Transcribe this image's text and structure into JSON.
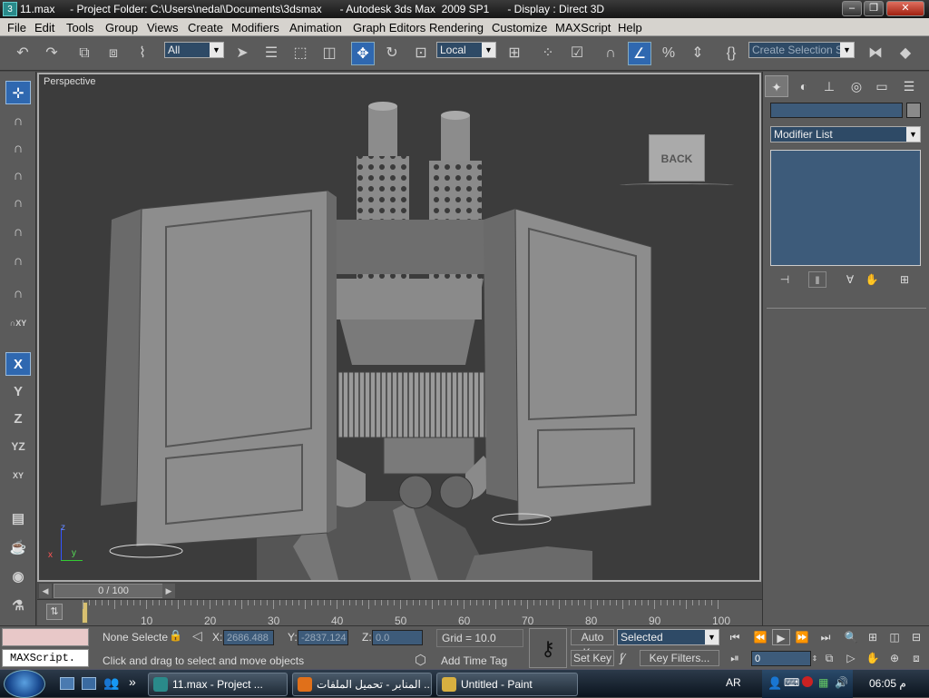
{
  "title_bar": {
    "text": "11.max     - Project Folder: C:\\Users\\nedal\\Documents\\3dsmax      - Autodesk 3ds Max  2009 SP1      - Display : Direct 3D"
  },
  "menu": {
    "items": [
      "File",
      "Edit",
      "Tools",
      "Group",
      "Views",
      "Create",
      "Modifiers",
      "Animation",
      "Graph Editors",
      "Rendering",
      "Customize",
      "MAXScript",
      "Help"
    ]
  },
  "toolbar": {
    "selection_filter": "All",
    "reference_coord": "Local",
    "named_selection_placeholder": "Create Selection Set"
  },
  "axis_constraints": {
    "x": "X",
    "y": "Y",
    "z": "Z",
    "yz": "YZ",
    "xy": "XY"
  },
  "viewport": {
    "label": "Perspective",
    "viewcube_label": "BACK",
    "axis_x": "x",
    "axis_y": "y",
    "axis_z": "z"
  },
  "command_panel": {
    "modifier_list_label": "Modifier List"
  },
  "time_slider": {
    "label": "0 / 100",
    "current": 0,
    "max": 100
  },
  "track_bar": {
    "ticks": [
      "10",
      "20",
      "30",
      "40",
      "50",
      "60",
      "70",
      "80",
      "90",
      "100"
    ]
  },
  "status": {
    "selection_status": "None Selecte",
    "x_label": "X:",
    "x_value": "2686.488",
    "y_label": "Y:",
    "y_value": "-2837.124",
    "z_label": "Z:",
    "z_value": "0.0",
    "grid": "Grid = 10.0",
    "prompt": "Click and drag to select and move objects",
    "add_time_tag": "Add Time Tag",
    "auto_key": "Auto Key",
    "set_key": "Set Key",
    "key_mode": "Selected",
    "key_filters": "Key Filters...",
    "current_frame": "0",
    "maxscript_listener": "MAXScript."
  },
  "taskbar": {
    "tasks": [
      "11.max     - Project ...",
      "المنابر - تحميل الملفات ...",
      "Untitled - Paint"
    ],
    "language": "AR",
    "time": "06:05 م"
  },
  "colors": {
    "accent": "#2f68b0",
    "panel": "#5b5b5b",
    "viewport_bg": "#3c3c3c"
  }
}
